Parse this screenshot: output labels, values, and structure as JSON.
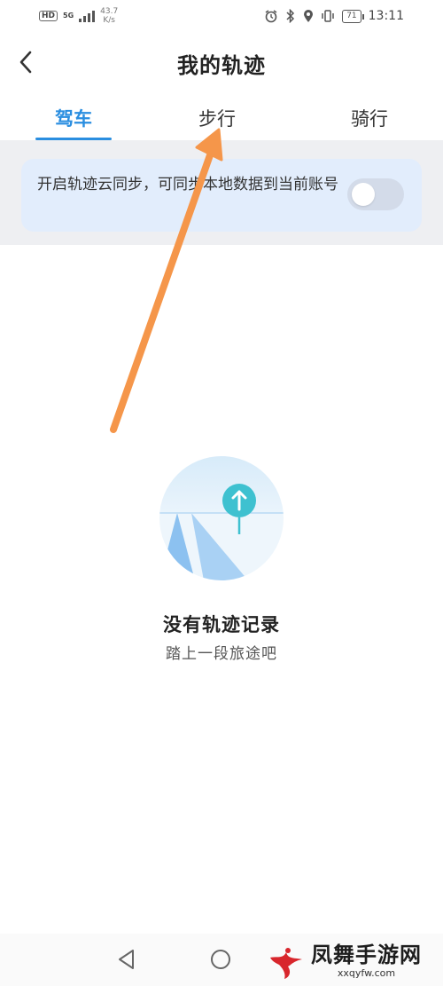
{
  "status_bar": {
    "hd": "HD",
    "network": "5G",
    "speed_value": "43.7",
    "speed_unit": "K/s",
    "battery": "71",
    "time": "13:11"
  },
  "header": {
    "title": "我的轨迹",
    "back_icon": "chevron-left-icon"
  },
  "tabs": [
    {
      "label": "驾车",
      "active": true
    },
    {
      "label": "步行",
      "active": false
    },
    {
      "label": "骑行",
      "active": false
    }
  ],
  "sync": {
    "text": "开启轨迹云同步，可同步本地数据到当前账号",
    "toggle_on": false
  },
  "empty_state": {
    "title": "没有轨迹记录",
    "subtitle": "踏上一段旅途吧"
  },
  "colors": {
    "accent": "#2a8ee0",
    "annotation_arrow": "#f5964a",
    "sync_card_bg": "#e2edfc"
  },
  "watermark": {
    "name": "凤舞手游网",
    "url": "xxqyfw.com"
  }
}
